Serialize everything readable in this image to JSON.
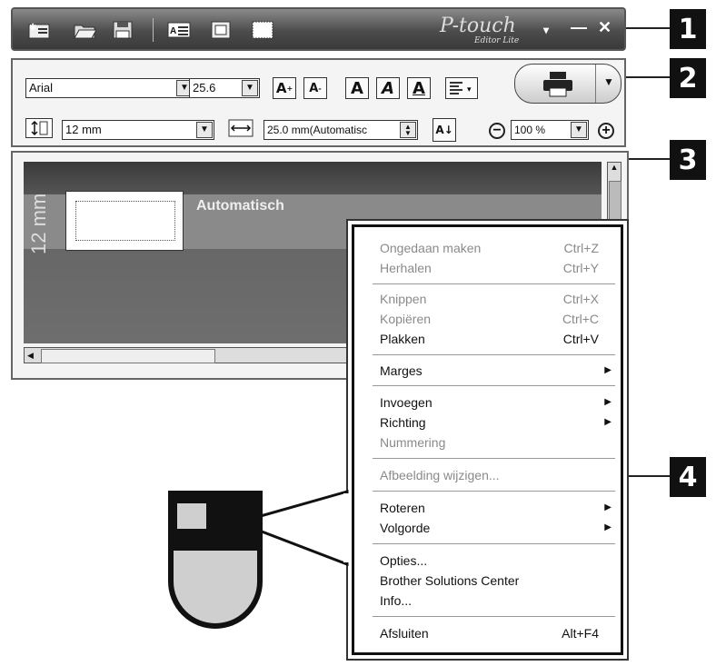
{
  "callouts": [
    "1",
    "2",
    "3",
    "4"
  ],
  "titlebar": {
    "brand": "P-touch",
    "brand_sub": "Editor Lite",
    "icons": [
      "new-label-icon",
      "open-folder-icon",
      "save-icon",
      "text-box-icon",
      "frame-icon",
      "border-icon"
    ],
    "window_buttons": [
      "▾",
      "—",
      "✕"
    ]
  },
  "format_bar": {
    "font": "Arial",
    "size": "25.6",
    "tape_width": "12 mm",
    "label_length": "25.0 mm(Automatisc",
    "zoom": "100 %"
  },
  "editor": {
    "tape_label": "12 mm",
    "length_label": "Automatisch"
  },
  "menu": {
    "items": [
      {
        "label": "Ongedaan maken",
        "shortcut": "Ctrl+Z",
        "enabled": false
      },
      {
        "label": "Herhalen",
        "shortcut": "Ctrl+Y",
        "enabled": false
      },
      {
        "label": "Knippen",
        "shortcut": "Ctrl+X",
        "enabled": false
      },
      {
        "label": "Kopiëren",
        "shortcut": "Ctrl+C",
        "enabled": false
      },
      {
        "label": "Plakken",
        "shortcut": "Ctrl+V",
        "enabled": true
      },
      {
        "label": "Marges",
        "shortcut": "",
        "enabled": true,
        "submenu": true
      },
      {
        "label": "Invoegen",
        "shortcut": "",
        "enabled": true,
        "submenu": true
      },
      {
        "label": "Richting",
        "shortcut": "",
        "enabled": true,
        "submenu": true
      },
      {
        "label": "Nummering",
        "shortcut": "",
        "enabled": false
      },
      {
        "label": "Afbeelding wijzigen...",
        "shortcut": "",
        "enabled": false
      },
      {
        "label": "Roteren",
        "shortcut": "",
        "enabled": true,
        "submenu": true
      },
      {
        "label": "Volgorde",
        "shortcut": "",
        "enabled": true,
        "submenu": true
      },
      {
        "label": "Opties...",
        "shortcut": "",
        "enabled": true
      },
      {
        "label": "Brother Solutions Center",
        "shortcut": "",
        "enabled": true
      },
      {
        "label": "Info...",
        "shortcut": "",
        "enabled": true
      },
      {
        "label": "Afsluiten",
        "shortcut": "Alt+F4",
        "enabled": true
      }
    ]
  }
}
